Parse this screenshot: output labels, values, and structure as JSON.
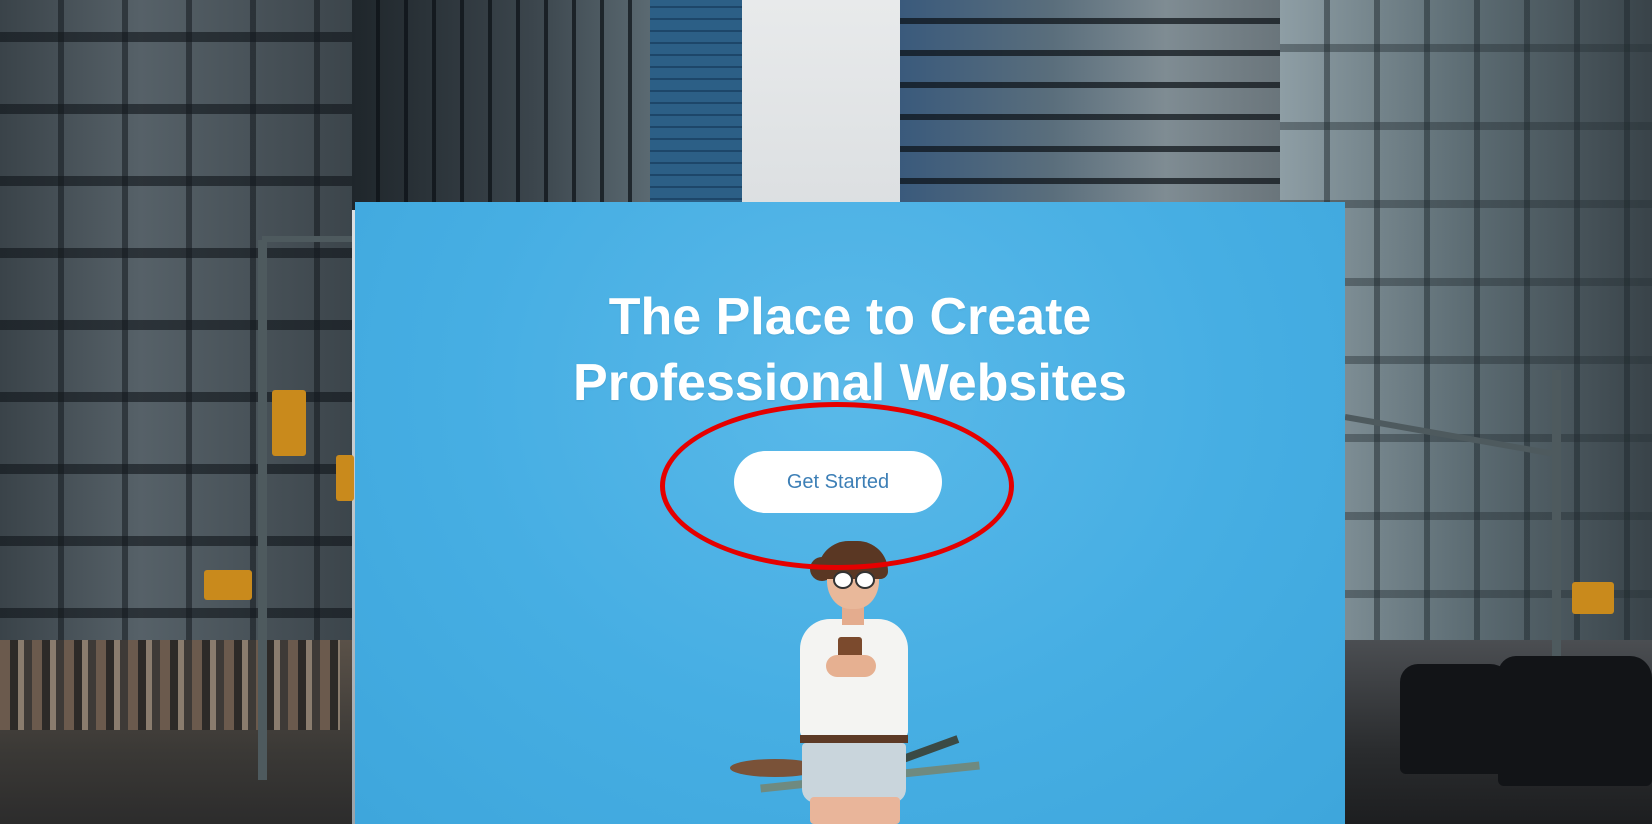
{
  "hero": {
    "title": "The Place to Create\nProfessional Websites",
    "cta_label": "Get Started"
  },
  "colors": {
    "hero_background": "#46aee3",
    "cta_text": "#3d7fb6",
    "annotation": "#e50000"
  }
}
